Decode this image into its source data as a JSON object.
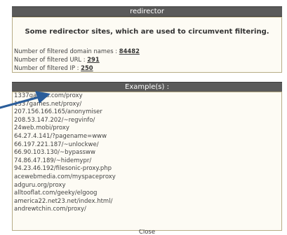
{
  "dialog": {
    "title": "redirector",
    "subtitle": "Some redirector sites, which are used to circumvent filtering.",
    "stats": [
      {
        "label": "Number of filtered domain names : ",
        "value": "84482"
      },
      {
        "label": "Number of filtered URL : ",
        "value": "291"
      },
      {
        "label": "Number of filtered IP : ",
        "value": "250"
      }
    ],
    "examples_title": "Example(s) :",
    "examples": [
      "1337games.com/proxy",
      "1337games.net/proxy/",
      "207.156.166.165/anonymiser",
      "208.53.147.202/~regvinfo/",
      "24web.mobi/proxy",
      "64.27.4.141/?pagename=www",
      "66.197.221.187/~unlockwe/",
      "66.90.103.130/~bypassww",
      "74.86.47.189/~hidemypr/",
      "94.23.46.192/filesonic-proxy.php",
      "acewebmedia.com/myspaceproxy",
      "adguru.org/proxy",
      "alltooflat.com/geeky/elgoog",
      "america22.net23.net/index.html/",
      "andrewtchin.com/proxy/"
    ],
    "close_label": "Close"
  },
  "colors": {
    "header_bg": "#5a5a5a",
    "panel_bg": "#fdfbf4",
    "panel_border": "#b7ac86",
    "arrow": "#2a5d9a"
  }
}
